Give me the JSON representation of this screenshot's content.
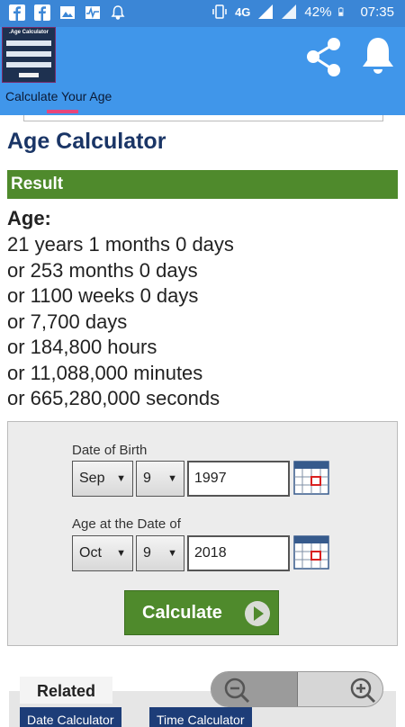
{
  "status_bar": {
    "network": "4G",
    "battery": "42%",
    "time": "07:35",
    "icons": [
      "facebook-icon",
      "facebook-icon",
      "image-icon",
      "pulse-icon",
      "bell-icon",
      "vibrate-icon",
      "signal-icon",
      "signal-icon",
      "battery-icon"
    ]
  },
  "app_bar": {
    "thumb_caption": ".Age Calculator",
    "tab_label": "Calculate Your Age",
    "accent": "#4096ea",
    "indicator_color": "#e8457a"
  },
  "page": {
    "title": "Age Calculator",
    "result_header": "Result",
    "age_label": "Age:",
    "age_lines": [
      "21 years 1 months 0 days",
      "or 253 months 0 days",
      "or 1100 weeks 0 days",
      "or 7,700 days",
      "or 184,800 hours",
      "or 11,088,000 minutes",
      "or 665,280,000 seconds"
    ]
  },
  "form": {
    "dob_label": "Date of Birth",
    "dob_month": "Sep",
    "dob_day": "9",
    "dob_year": "1997",
    "at_label": "Age at the Date of",
    "at_month": "Oct",
    "at_day": "9",
    "at_year": "2018",
    "calculate_label": "Calculate",
    "button_color": "#4f8a2c"
  },
  "bottom": {
    "related_tab": "Related",
    "links": [
      "Date Calculator",
      "Time Calculator"
    ]
  }
}
